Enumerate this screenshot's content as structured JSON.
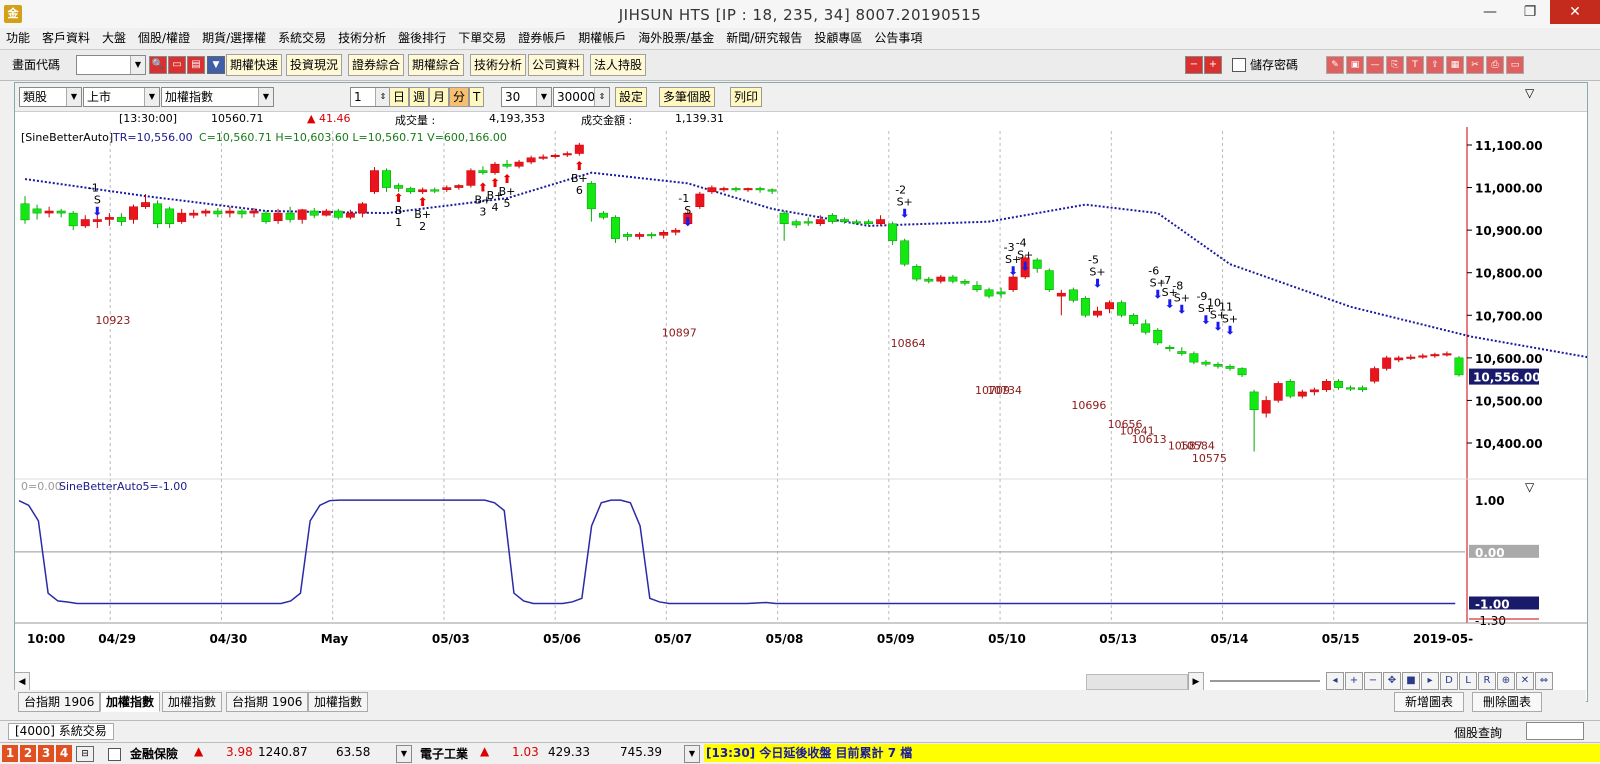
{
  "window": {
    "app_icon": "金",
    "title": "JIHSUN HTS      [IP : 18, 235, 34] 8007.20190515",
    "minimize_glyph": "—",
    "maximize_glyph": "❐",
    "close_glyph": "✕"
  },
  "menu": [
    "功能",
    "客戶資料",
    "大盤",
    "個股/權證",
    "期貨/選擇權",
    "系統交易",
    "技術分析",
    "盤後排行",
    "下單交易",
    "證券帳戶",
    "期權帳戶",
    "海外股票/基金",
    "新聞/研究報告",
    "投顧專區",
    "公告事項"
  ],
  "toolbar": {
    "code_label": "畫面代碼",
    "buttons": [
      "期權快速",
      "投資現況",
      "證券綜合",
      "期權綜合",
      "技術分析",
      "公司資料",
      "法人持股"
    ],
    "save_password_label": "儲存密碼"
  },
  "chart_toolbar": {
    "category": "類股",
    "market": "上市",
    "index": "加權指數",
    "count": "1",
    "periods": [
      "日",
      "週",
      "月",
      "分",
      "T"
    ],
    "period_value": "30",
    "bars_value": "30000",
    "set_button": "設定",
    "multi_button": "多筆個股",
    "print_button": "列印"
  },
  "infobar": {
    "time": "[13:30:00]",
    "price": "10560.71",
    "change": "▲ 41.46",
    "volume_label": "成交量 :",
    "volume": "4,193,353",
    "amount_label": "成交金額 :",
    "amount": "1,139.31"
  },
  "chart_data": {
    "type": "candlestick",
    "indicator_label": "[SineBetterAuto]",
    "tr_label": "TR=10,556.00",
    "ohlcv_label": "C=10,560.71 H=10,603.60 L=10,560.71 V=600,166.00",
    "y_axis": {
      "min": 10400,
      "max": 11100,
      "ticks": [
        "11,100.00",
        "11,000.00",
        "10,900.00",
        "10,800.00",
        "10,700.00",
        "10,600.00",
        "10,500.00",
        "10,400.00"
      ],
      "last": "10,556.00"
    },
    "x_labels": [
      "10:00",
      "04/29",
      "04/30",
      "May",
      "05/03",
      "05/06",
      "05/07",
      "05/08",
      "05/09",
      "05/10",
      "05/13",
      "05/14",
      "05/15",
      "2019-05-"
    ],
    "candles": [
      [
        10962,
        10924,
        10980,
        10915
      ],
      [
        10950,
        10940,
        10960,
        10925
      ],
      [
        10940,
        10945,
        10955,
        10930
      ],
      [
        10945,
        10940,
        10950,
        10930
      ],
      [
        10940,
        10910,
        10945,
        10900
      ],
      [
        10910,
        10925,
        10935,
        10905
      ],
      [
        10920,
        10925,
        10935,
        10905
      ],
      [
        10925,
        10930,
        10940,
        10910
      ],
      [
        10930,
        10920,
        10940,
        10910
      ],
      [
        10925,
        10955,
        10960,
        10915
      ],
      [
        10955,
        10965,
        10985,
        10950
      ],
      [
        10962,
        10915,
        10970,
        10905
      ],
      [
        10950,
        10915,
        10955,
        10905
      ],
      [
        10920,
        10940,
        10950,
        10915
      ],
      [
        10935,
        10940,
        10948,
        10928
      ],
      [
        10940,
        10945,
        10950,
        10932
      ],
      [
        10945,
        10938,
        10952,
        10930
      ],
      [
        10940,
        10945,
        10955,
        10930
      ],
      [
        10945,
        10938,
        10950,
        10928
      ],
      [
        10940,
        10945,
        10952,
        10930
      ],
      [
        10940,
        10920,
        10945,
        10915
      ],
      [
        10922,
        10940,
        10950,
        10915
      ],
      [
        10940,
        10925,
        10955,
        10918
      ],
      [
        10925,
        10948,
        10950,
        10915
      ],
      [
        10945,
        10935,
        10952,
        10928
      ],
      [
        10935,
        10945,
        10950,
        10932
      ],
      [
        10945,
        10930,
        10950,
        10925
      ],
      [
        10930,
        10940,
        10948,
        10925
      ],
      [
        10940,
        10962,
        10966,
        10930
      ],
      [
        10990,
        11040,
        11048,
        10985
      ],
      [
        11040,
        11000,
        11045,
        10990
      ],
      [
        11005,
        10998,
        11010,
        10990
      ],
      [
        10998,
        10990,
        11002,
        10985
      ],
      [
        10990,
        10995,
        11000,
        10985
      ],
      [
        10995,
        10992,
        11000,
        10987
      ],
      [
        10995,
        11000,
        11005,
        10990
      ],
      [
        11000,
        11005,
        11008,
        10995
      ],
      [
        11005,
        11040,
        11045,
        11000
      ],
      [
        11040,
        11035,
        11050,
        11030
      ],
      [
        11035,
        11055,
        11060,
        11030
      ],
      [
        11055,
        11050,
        11065,
        11045
      ],
      [
        11050,
        11060,
        11065,
        11045
      ],
      [
        11060,
        11070,
        11075,
        11055
      ],
      [
        11070,
        11072,
        11078,
        11065
      ],
      [
        11075,
        11076,
        11080,
        11068
      ],
      [
        11078,
        11080,
        11085,
        11072
      ],
      [
        11080,
        11100,
        11105,
        11075
      ],
      [
        11010,
        10950,
        11015,
        10920
      ],
      [
        10940,
        10930,
        10945,
        10925
      ],
      [
        10930,
        10880,
        10935,
        10870
      ],
      [
        10890,
        10885,
        10895,
        10875
      ],
      [
        10885,
        10890,
        10895,
        10878
      ],
      [
        10890,
        10888,
        10895,
        10880
      ],
      [
        10888,
        10895,
        10900,
        10880
      ],
      [
        10895,
        10900,
        10905,
        10888
      ],
      [
        10915,
        10940,
        10950,
        10910
      ],
      [
        10955,
        10985,
        10990,
        10950
      ],
      [
        10990,
        11000,
        11005,
        10985
      ],
      [
        10995,
        10998,
        11002,
        10990
      ],
      [
        10998,
        10995,
        11002,
        10990
      ],
      [
        10995,
        10998,
        11000,
        10990
      ],
      [
        10998,
        10995,
        11002,
        10988
      ],
      [
        10995,
        10992,
        10998,
        10985
      ],
      [
        10940,
        10915,
        10945,
        10875
      ],
      [
        10920,
        10912,
        10925,
        10905
      ],
      [
        10920,
        10918,
        10930,
        10910
      ],
      [
        10915,
        10925,
        10935,
        10910
      ],
      [
        10935,
        10920,
        10940,
        10915
      ],
      [
        10925,
        10920,
        10930,
        10915
      ],
      [
        10920,
        10918,
        10925,
        10912
      ],
      [
        10920,
        10915,
        10925,
        10910
      ],
      [
        10915,
        10925,
        10935,
        10910
      ],
      [
        10915,
        10875,
        10920,
        10865
      ],
      [
        10875,
        10820,
        10880,
        10815
      ],
      [
        10815,
        10785,
        10820,
        10780
      ],
      [
        10785,
        10780,
        10790,
        10775
      ],
      [
        10780,
        10790,
        10795,
        10775
      ],
      [
        10790,
        10780,
        10795,
        10775
      ],
      [
        10780,
        10775,
        10785,
        10770
      ],
      [
        10770,
        10760,
        10780,
        10755
      ],
      [
        10760,
        10745,
        10765,
        10740
      ],
      [
        10755,
        10750,
        10765,
        10740
      ],
      [
        10760,
        10790,
        10795,
        10755
      ],
      [
        10790,
        10835,
        10840,
        10785
      ],
      [
        10830,
        10810,
        10835,
        10800
      ],
      [
        10805,
        10760,
        10810,
        10755
      ],
      [
        10745,
        10752,
        10760,
        10700
      ],
      [
        10760,
        10735,
        10765,
        10730
      ],
      [
        10740,
        10700,
        10745,
        10695
      ],
      [
        10700,
        10710,
        10720,
        10695
      ],
      [
        10715,
        10730,
        10735,
        10705
      ],
      [
        10730,
        10700,
        10735,
        10695
      ],
      [
        10700,
        10680,
        10705,
        10675
      ],
      [
        10680,
        10660,
        10690,
        10655
      ],
      [
        10665,
        10635,
        10670,
        10630
      ],
      [
        10625,
        10622,
        10630,
        10615
      ],
      [
        10615,
        10610,
        10625,
        10605
      ],
      [
        10610,
        10590,
        10615,
        10585
      ],
      [
        10590,
        10585,
        10595,
        10580
      ],
      [
        10585,
        10580,
        10590,
        10575
      ],
      [
        10580,
        10575,
        10585,
        10570
      ],
      [
        10575,
        10560,
        10578,
        10555
      ],
      [
        10520,
        10478,
        10525,
        10380
      ],
      [
        10470,
        10500,
        10510,
        10460
      ],
      [
        10500,
        10540,
        10545,
        10495
      ],
      [
        10545,
        10510,
        10550,
        10505
      ],
      [
        10510,
        10520,
        10525,
        10505
      ],
      [
        10520,
        10525,
        10530,
        10512
      ],
      [
        10525,
        10545,
        10550,
        10520
      ],
      [
        10545,
        10530,
        10550,
        10525
      ],
      [
        10530,
        10528,
        10535,
        10522
      ],
      [
        10530,
        10525,
        10535,
        10520
      ],
      [
        10545,
        10575,
        10580,
        10540
      ],
      [
        10575,
        10600,
        10605,
        10570
      ],
      [
        10595,
        10600,
        10605,
        10590
      ],
      [
        10600,
        10602,
        10608,
        10595
      ],
      [
        10602,
        10605,
        10610,
        10598
      ],
      [
        10605,
        10608,
        10612,
        10600
      ],
      [
        10608,
        10610,
        10615,
        10603
      ],
      [
        10600,
        10560,
        10604,
        10556
      ]
    ],
    "trend_line": [
      [
        0,
        11020
      ],
      [
        10,
        10980
      ],
      [
        20,
        10945
      ],
      [
        30,
        10940
      ],
      [
        40,
        10975
      ],
      [
        47,
        11035
      ],
      [
        55,
        11010
      ],
      [
        62,
        10950
      ],
      [
        70,
        10910
      ],
      [
        80,
        10920
      ],
      [
        88,
        10960
      ],
      [
        94,
        10940
      ],
      [
        100,
        10820
      ],
      [
        110,
        10720
      ],
      [
        120,
        10650
      ],
      [
        130,
        10600
      ],
      [
        140,
        10560
      ],
      [
        149,
        10560
      ]
    ],
    "signals": [
      {
        "type": "sell",
        "label_top": "-1",
        "label_mid": "S",
        "bar": 6,
        "price": 10930
      },
      {
        "type": "buy",
        "label_top": "B",
        "label_bot": "1",
        "bar": 31,
        "price": 10985
      },
      {
        "type": "buy",
        "label_top": "B+",
        "label_bot": "2",
        "bar": 33,
        "price": 10975
      },
      {
        "type": "buy",
        "label_top": "B+",
        "label_bot": "3",
        "bar": 38,
        "price": 11010
      },
      {
        "type": "buy",
        "label_top": "B+",
        "label_bot": "4",
        "bar": 39,
        "price": 11020
      },
      {
        "type": "buy",
        "label_top": "B+",
        "label_bot": "5",
        "bar": 40,
        "price": 11030
      },
      {
        "type": "buy",
        "label_top": "B+",
        "label_bot": "6",
        "bar": 46,
        "price": 11060
      },
      {
        "type": "sell",
        "label_top": "-1",
        "label_mid": "S",
        "bar": 55,
        "price": 10905
      },
      {
        "type": "sell",
        "label_top": "-2",
        "label_mid": "S+",
        "bar": 73,
        "price": 10925
      },
      {
        "type": "sell",
        "label_top": "-3",
        "label_mid": "S+",
        "bar": 82,
        "price": 10790
      },
      {
        "type": "sell",
        "label_top": "-4",
        "label_mid": "S+",
        "bar": 83,
        "price": 10800
      },
      {
        "type": "sell",
        "label_top": "-5",
        "label_mid": "S+",
        "bar": 89,
        "price": 10760
      },
      {
        "type": "sell",
        "label_top": "-6",
        "label_mid": "S+",
        "bar": 94,
        "price": 10735
      },
      {
        "type": "sell",
        "label_top": "-7",
        "label_mid": "S+",
        "bar": 95,
        "price": 10712
      },
      {
        "type": "sell",
        "label_top": "-8",
        "label_mid": "S+",
        "bar": 96,
        "price": 10700
      },
      {
        "type": "sell",
        "label_top": "-9",
        "label_mid": "S+",
        "bar": 98,
        "price": 10675
      },
      {
        "type": "sell",
        "label_top": "10",
        "label_mid": "S+",
        "bar": 99,
        "price": 10660
      },
      {
        "type": "sell",
        "label_top": "11",
        "label_mid": "S+",
        "bar": 100,
        "price": 10650
      }
    ],
    "price_labels": [
      {
        "text": "10923",
        "bar": 7,
        "price": 10680
      },
      {
        "text": "10897",
        "bar": 54,
        "price": 10650
      },
      {
        "text": "10864",
        "bar": 73,
        "price": 10625
      },
      {
        "text": "10709",
        "bar": 80,
        "price": 10515
      },
      {
        "text": "10734",
        "bar": 81,
        "price": 10515
      },
      {
        "text": "10696",
        "bar": 88,
        "price": 10480
      },
      {
        "text": "10656",
        "bar": 91,
        "price": 10435
      },
      {
        "text": "10641",
        "bar": 92,
        "price": 10420
      },
      {
        "text": "10613",
        "bar": 93,
        "price": 10400
      },
      {
        "text": "10587",
        "bar": 96,
        "price": 10385
      },
      {
        "text": "10584",
        "bar": 97,
        "price": 10385
      },
      {
        "text": "10575",
        "bar": 98,
        "price": 10355
      }
    ],
    "sub": {
      "zero_label": "0=0.00",
      "name_label": "SineBetterAuto5=-1.00",
      "y_labels": [
        "1.00",
        "0.00",
        "-1.00",
        "-1.30"
      ],
      "ymin": -1.3,
      "ymax": 1.1,
      "values": [
        0.99,
        0.9,
        0.6,
        -0.8,
        -0.95,
        -0.97,
        -1,
        -1,
        -1,
        -1,
        -1,
        -1,
        -1,
        -1,
        -1,
        -1,
        -1,
        -1,
        -1,
        -1,
        -1,
        -1,
        -1,
        -1,
        -1,
        -1,
        -1,
        -1,
        -0.95,
        -0.8,
        0.6,
        0.9,
        0.99,
        1,
        1,
        1,
        1,
        1,
        1,
        1,
        1,
        1,
        1,
        1,
        1,
        1,
        1,
        1,
        1,
        0.95,
        0.8,
        -0.8,
        -0.95,
        -1,
        -1,
        -1,
        -1,
        -0.97,
        -0.9,
        0.5,
        0.95,
        1,
        1,
        0.95,
        0.5,
        -0.9,
        -0.97,
        -1,
        -1,
        -1,
        -1,
        -1,
        -1,
        -1,
        -1,
        -1,
        -0.99,
        -0.98,
        -1,
        -1,
        -1,
        -1,
        -1,
        -1,
        -1,
        -1,
        -1,
        -1,
        -1,
        -1,
        -1,
        -1,
        -1,
        -1,
        -1,
        -1,
        -1,
        -1,
        -1,
        -1,
        -1,
        -1,
        -1,
        -1,
        -1,
        -1,
        -1,
        -1,
        -1,
        -1,
        -1,
        -1,
        -1,
        -1,
        -1,
        -1,
        -1,
        -1,
        -1,
        -1,
        -1,
        -1,
        -1,
        -1,
        -1,
        -1,
        -1,
        -1,
        -1,
        -1,
        -1,
        -1,
        -1,
        -1,
        -1,
        -1,
        -1,
        -1,
        -1,
        -1,
        -1,
        -1,
        -1,
        -1,
        -1,
        -1,
        -1,
        -1,
        -1
      ]
    }
  },
  "bottom_tabs": [
    "台指期 1906",
    "加權指數",
    "加權指數",
    "台指期 1906",
    "加權指數"
  ],
  "bottom_right_buttons": [
    "新增圖表",
    "刪除圖表"
  ],
  "nav_glyphs": [
    "◂",
    "+",
    "−",
    "✥",
    "■",
    "▸",
    "D",
    "L",
    "R",
    "⊕",
    "✕",
    "⇔"
  ],
  "status1": {
    "left": "[4000]  系統交易",
    "right_label": "個股查詢"
  },
  "status2": {
    "nums": [
      "1",
      "2",
      "3",
      "4"
    ],
    "sector1": "金融保險",
    "sector1_change": "3.98",
    "sector1_index": "1240.87",
    "sector1_value": "63.58",
    "sector2": "電子工業",
    "sector2_change": "1.03",
    "sector2_index": "429.33",
    "sector2_value": "745.39",
    "marquee": "[13:30] 今日延後收盤 目前累計 7 檔",
    "up_arrow": "▲"
  }
}
